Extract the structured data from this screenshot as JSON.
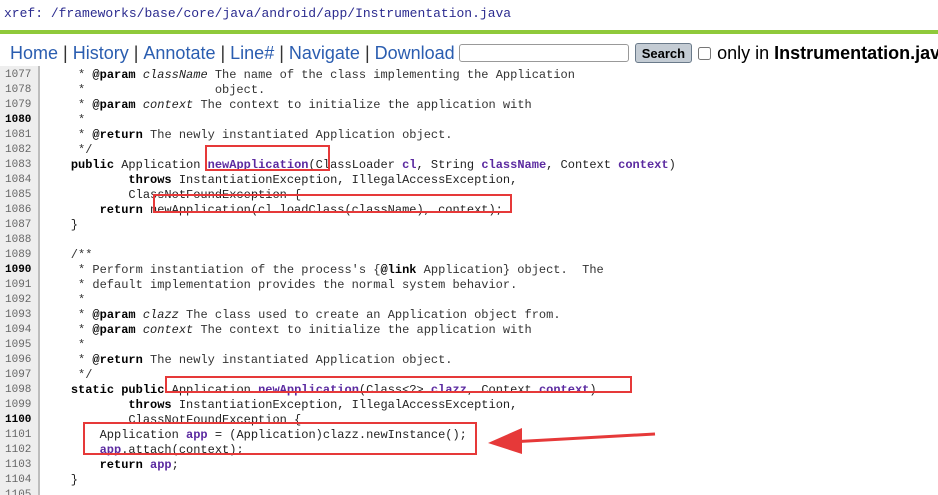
{
  "xref": {
    "label": "xref:",
    "path": "/frameworks/base/core/java/android/app/Instrumentation.java"
  },
  "nav": {
    "links": [
      "Home",
      "History",
      "Annotate",
      "Line#",
      "Navigate",
      "Download"
    ],
    "search_placeholder": "",
    "search_button": "Search",
    "only_in": "only in",
    "file": "Instrumentation.java"
  },
  "colors": {
    "accent_bar": "#8fc93a",
    "highlight": "#e63939",
    "link": "#2a5db0"
  },
  "code": {
    "lines": [
      {
        "n": "1077",
        "b": false,
        "parts": [
          {
            "t": "     * ",
            "c": "cm"
          },
          {
            "t": "@param",
            "c": "kw"
          },
          {
            "t": " ",
            "c": "cm"
          },
          {
            "t": "className",
            "c": "it"
          },
          {
            "t": " The name of the class implementing the Application",
            "c": "cm"
          }
        ]
      },
      {
        "n": "1078",
        "b": false,
        "parts": [
          {
            "t": "     *                  object.",
            "c": "cm"
          }
        ]
      },
      {
        "n": "1079",
        "b": false,
        "parts": [
          {
            "t": "     * ",
            "c": "cm"
          },
          {
            "t": "@param",
            "c": "kw"
          },
          {
            "t": " ",
            "c": "cm"
          },
          {
            "t": "context",
            "c": "it"
          },
          {
            "t": " The context to initialize the application with",
            "c": "cm"
          }
        ]
      },
      {
        "n": "1080",
        "b": true,
        "parts": [
          {
            "t": "     *",
            "c": "cm"
          }
        ]
      },
      {
        "n": "1081",
        "b": false,
        "parts": [
          {
            "t": "     * ",
            "c": "cm"
          },
          {
            "t": "@return",
            "c": "kw"
          },
          {
            "t": " The newly instantiated Application object.",
            "c": "cm"
          }
        ]
      },
      {
        "n": "1082",
        "b": false,
        "parts": [
          {
            "t": "     */",
            "c": "cm"
          }
        ]
      },
      {
        "n": "1083",
        "b": false,
        "parts": [
          {
            "t": "    ",
            "c": ""
          },
          {
            "t": "public",
            "c": "kw"
          },
          {
            "t": " Application ",
            "c": ""
          },
          {
            "t": "newApplication",
            "c": "pv"
          },
          {
            "t": "(ClassLoader ",
            "c": ""
          },
          {
            "t": "cl",
            "c": "pv"
          },
          {
            "t": ", String ",
            "c": ""
          },
          {
            "t": "className",
            "c": "pv"
          },
          {
            "t": ", Context ",
            "c": ""
          },
          {
            "t": "context",
            "c": "pv"
          },
          {
            "t": ")",
            "c": ""
          }
        ]
      },
      {
        "n": "1084",
        "b": false,
        "parts": [
          {
            "t": "            ",
            "c": ""
          },
          {
            "t": "throws",
            "c": "kw"
          },
          {
            "t": " InstantiationException, IllegalAccessException,",
            "c": ""
          }
        ]
      },
      {
        "n": "1085",
        "b": false,
        "parts": [
          {
            "t": "            ClassNotFoundException {",
            "c": ""
          }
        ]
      },
      {
        "n": "1086",
        "b": false,
        "parts": [
          {
            "t": "        ",
            "c": ""
          },
          {
            "t": "return",
            "c": "kw"
          },
          {
            "t": " newApplication(cl.loadClass(className), context);",
            "c": ""
          }
        ]
      },
      {
        "n": "1087",
        "b": false,
        "parts": [
          {
            "t": "    }",
            "c": ""
          }
        ]
      },
      {
        "n": "1088",
        "b": false,
        "parts": [
          {
            "t": "",
            "c": ""
          }
        ]
      },
      {
        "n": "1089",
        "b": false,
        "parts": [
          {
            "t": "    /**",
            "c": "cm"
          }
        ]
      },
      {
        "n": "1090",
        "b": true,
        "parts": [
          {
            "t": "     * Perform instantiation of the process's {",
            "c": "cm"
          },
          {
            "t": "@link",
            "c": "kw"
          },
          {
            "t": " Application} object.  The",
            "c": "cm"
          }
        ]
      },
      {
        "n": "1091",
        "b": false,
        "parts": [
          {
            "t": "     * default implementation provides the normal system behavior.",
            "c": "cm"
          }
        ]
      },
      {
        "n": "1092",
        "b": false,
        "parts": [
          {
            "t": "     *",
            "c": "cm"
          }
        ]
      },
      {
        "n": "1093",
        "b": false,
        "parts": [
          {
            "t": "     * ",
            "c": "cm"
          },
          {
            "t": "@param",
            "c": "kw"
          },
          {
            "t": " ",
            "c": "cm"
          },
          {
            "t": "clazz",
            "c": "it"
          },
          {
            "t": " The class used to create an Application object from.",
            "c": "cm"
          }
        ]
      },
      {
        "n": "1094",
        "b": false,
        "parts": [
          {
            "t": "     * ",
            "c": "cm"
          },
          {
            "t": "@param",
            "c": "kw"
          },
          {
            "t": " ",
            "c": "cm"
          },
          {
            "t": "context",
            "c": "it"
          },
          {
            "t": " The context to initialize the application with",
            "c": "cm"
          }
        ]
      },
      {
        "n": "1095",
        "b": false,
        "parts": [
          {
            "t": "     *",
            "c": "cm"
          }
        ]
      },
      {
        "n": "1096",
        "b": false,
        "parts": [
          {
            "t": "     * ",
            "c": "cm"
          },
          {
            "t": "@return",
            "c": "kw"
          },
          {
            "t": " The newly instantiated Application object.",
            "c": "cm"
          }
        ]
      },
      {
        "n": "1097",
        "b": false,
        "parts": [
          {
            "t": "     */",
            "c": "cm"
          }
        ]
      },
      {
        "n": "1098",
        "b": false,
        "parts": [
          {
            "t": "    ",
            "c": ""
          },
          {
            "t": "static",
            "c": "kw"
          },
          {
            "t": " ",
            "c": ""
          },
          {
            "t": "public",
            "c": "kw"
          },
          {
            "t": " Application ",
            "c": ""
          },
          {
            "t": "newApplication",
            "c": "pv"
          },
          {
            "t": "(Class<?> ",
            "c": ""
          },
          {
            "t": "clazz",
            "c": "pv"
          },
          {
            "t": ", Context ",
            "c": ""
          },
          {
            "t": "context",
            "c": "pv"
          },
          {
            "t": ")",
            "c": ""
          }
        ]
      },
      {
        "n": "1099",
        "b": false,
        "parts": [
          {
            "t": "            ",
            "c": ""
          },
          {
            "t": "throws",
            "c": "kw"
          },
          {
            "t": " InstantiationException, IllegalAccessException,",
            "c": ""
          }
        ]
      },
      {
        "n": "1100",
        "b": true,
        "parts": [
          {
            "t": "            ClassNotFoundException {",
            "c": ""
          }
        ]
      },
      {
        "n": "1101",
        "b": false,
        "parts": [
          {
            "t": "        Application ",
            "c": ""
          },
          {
            "t": "app",
            "c": "pv"
          },
          {
            "t": " = (Application)clazz.newInstance();",
            "c": ""
          }
        ]
      },
      {
        "n": "1102",
        "b": false,
        "parts": [
          {
            "t": "        ",
            "c": ""
          },
          {
            "t": "app",
            "c": "pv"
          },
          {
            "t": ".attach(context);",
            "c": ""
          }
        ]
      },
      {
        "n": "1103",
        "b": false,
        "parts": [
          {
            "t": "        ",
            "c": ""
          },
          {
            "t": "return",
            "c": "kw"
          },
          {
            "t": " ",
            "c": ""
          },
          {
            "t": "app",
            "c": "pv"
          },
          {
            "t": ";",
            "c": ""
          }
        ]
      },
      {
        "n": "1104",
        "b": false,
        "parts": [
          {
            "t": "    }",
            "c": ""
          }
        ]
      },
      {
        "n": "1105",
        "b": false,
        "parts": [
          {
            "t": "",
            "c": ""
          }
        ]
      }
    ]
  }
}
